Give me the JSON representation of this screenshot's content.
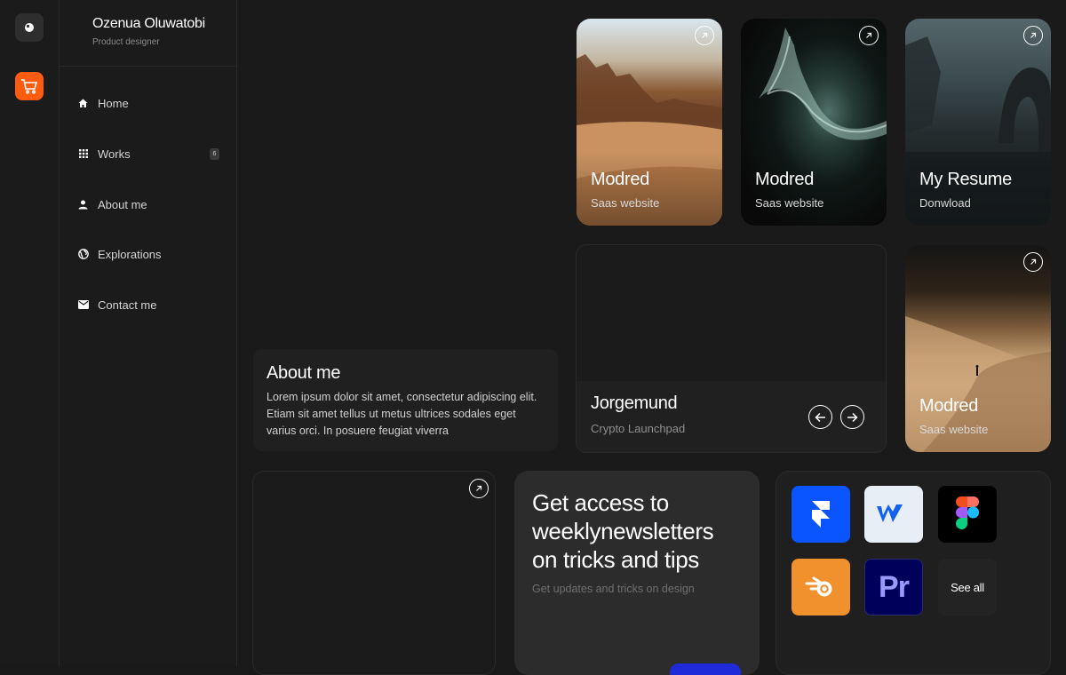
{
  "profile": {
    "name": "Ozenua Oluwatobi",
    "role": "Product designer"
  },
  "nav": {
    "items": [
      {
        "label": "Home",
        "icon": "home-icon"
      },
      {
        "label": "Works",
        "icon": "grid-icon",
        "badge": "6"
      },
      {
        "label": "About me",
        "icon": "user-icon"
      },
      {
        "label": "Explorations",
        "icon": "globe-icon"
      },
      {
        "label": "Contact me",
        "icon": "mail-icon"
      }
    ]
  },
  "cards": {
    "modred1": {
      "title": "Modred",
      "sub": "Saas website"
    },
    "modred2": {
      "title": "Modred",
      "sub": "Saas website"
    },
    "resume": {
      "title": "My Resume",
      "sub": "Donwload"
    },
    "modred3": {
      "title": "Modred",
      "sub": "Saas website"
    }
  },
  "about": {
    "title": "About me",
    "text": "Lorem ipsum dolor sit amet, consectetur adipiscing elit. Etiam sit amet tellus ut metus ultrices sodales eget varius orci. In posuere feugiat viverra"
  },
  "jorgemund": {
    "title": "Jorgemund",
    "sub": "Crypto Launchpad"
  },
  "newsletter": {
    "title": "Get access to weeklynewsletters on tricks and tips",
    "sub": "Get updates and tricks on design"
  },
  "tools": {
    "items": [
      "framer-icon",
      "webflow-icon",
      "figma-icon",
      "blender-icon",
      "premiere-icon"
    ],
    "see_all": "See all",
    "premiere_label": "Pr"
  },
  "colors": {
    "accent": "#ff5c10",
    "background": "#1a1a1a",
    "cta": "#1f2bd9"
  }
}
